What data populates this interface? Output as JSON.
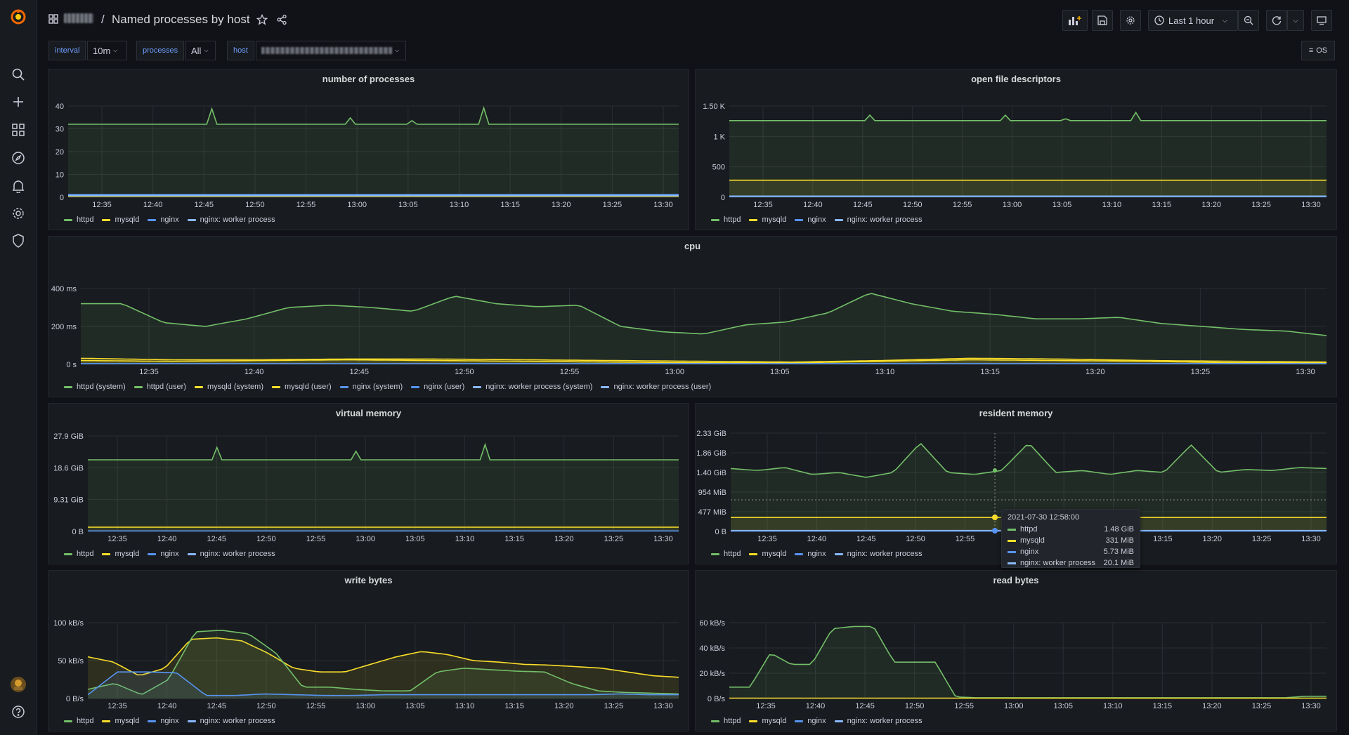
{
  "colors": {
    "httpd": "#73bf69",
    "mysqld": "#fade2a",
    "nginx": "#5794f2",
    "nginx_worker": "#8ab8ff"
  },
  "breadcrumb": {
    "separator": "/",
    "title": "Named processes by host"
  },
  "toolbar": {
    "time_range": "Last 1 hour"
  },
  "variables": [
    {
      "label": "interval",
      "value": "10m"
    },
    {
      "label": "processes",
      "value": "All"
    },
    {
      "label": "host",
      "value": ""
    }
  ],
  "row_toggle": {
    "label": "OS"
  },
  "xticks_hour": [
    "12:35",
    "12:40",
    "12:45",
    "12:50",
    "12:55",
    "13:00",
    "13:05",
    "13:10",
    "13:15",
    "13:20",
    "13:25",
    "13:30"
  ],
  "panels": {
    "processes": {
      "title": "number of processes",
      "yticks": [
        "40",
        "30",
        "20",
        "10",
        "0"
      ]
    },
    "fds": {
      "title": "open file descriptors",
      "yticks": [
        "1.50 K",
        "1 K",
        "500",
        "0"
      ]
    },
    "cpu": {
      "title": "cpu",
      "yticks": [
        "400 ms",
        "200 ms",
        "0 s"
      ]
    },
    "vmem": {
      "title": "virtual memory",
      "yticks": [
        "27.9 GiB",
        "18.6 GiB",
        "9.31 GiB",
        "0 B"
      ]
    },
    "rmem": {
      "title": "resident memory",
      "yticks": [
        "2.33 GiB",
        "1.86 GiB",
        "1.40 GiB",
        "954 MiB",
        "477 MiB",
        "0 B"
      ]
    },
    "write": {
      "title": "write bytes",
      "yticks": [
        "100 kB/s",
        "50 kB/s",
        "0 B/s"
      ]
    },
    "read": {
      "title": "read bytes",
      "yticks": [
        "60 kB/s",
        "40 kB/s",
        "20 kB/s",
        "0 B/s"
      ]
    }
  },
  "legend4": [
    "httpd",
    "mysqld",
    "nginx",
    "nginx: worker process"
  ],
  "legend_cpu": [
    "httpd (system)",
    "httpd (user)",
    "mysqld (system)",
    "mysqld (user)",
    "nginx (system)",
    "nginx (user)",
    "nginx: worker process (system)",
    "nginx: worker process (user)"
  ],
  "tooltip": {
    "time": "2021-07-30 12:58:00",
    "rows": [
      {
        "name": "httpd",
        "value": "1.48 GiB"
      },
      {
        "name": "mysqld",
        "value": "331 MiB"
      },
      {
        "name": "nginx",
        "value": "5.73 MiB"
      },
      {
        "name": "nginx: worker process",
        "value": "20.1 MiB"
      }
    ]
  },
  "chart_data": [
    {
      "type": "area",
      "title": "number of processes",
      "ylim": [
        0,
        40
      ],
      "x": [
        "12:31",
        "12:35",
        "12:40",
        "12:45",
        "12:50",
        "12:55",
        "13:00",
        "13:05",
        "13:10",
        "13:15",
        "13:20",
        "13:25",
        "13:31"
      ],
      "series": [
        {
          "name": "httpd",
          "values": [
            32,
            32,
            32,
            32,
            32,
            32,
            32,
            32,
            32,
            32,
            32,
            32,
            32
          ],
          "spikes": [
            [
              12.75,
              38
            ],
            [
              13.02,
              35
            ],
            [
              13.08,
              34
            ],
            [
              13.15,
              39
            ]
          ]
        },
        {
          "name": "mysqld",
          "values": [
            1,
            1,
            1,
            1,
            1,
            1,
            1,
            1,
            1,
            1,
            1,
            1,
            1
          ]
        },
        {
          "name": "nginx",
          "values": [
            2,
            2,
            2,
            2,
            2,
            2,
            2,
            2,
            2,
            2,
            2,
            2,
            2
          ]
        },
        {
          "name": "nginx: worker process",
          "values": [
            1,
            1,
            1,
            1,
            1,
            1,
            1,
            1,
            1,
            1,
            1,
            1,
            1
          ]
        }
      ]
    },
    {
      "type": "area",
      "title": "open file descriptors",
      "ylim": [
        0,
        1500
      ],
      "series": [
        {
          "name": "httpd",
          "values": [
            1260,
            1260,
            1250,
            1260,
            1260,
            1260,
            1260,
            1260,
            1260,
            1260,
            1260,
            1260,
            1260
          ]
        },
        {
          "name": "mysqld",
          "values": [
            280,
            280,
            280,
            280,
            280,
            280,
            280,
            280,
            280,
            290,
            280,
            280,
            280
          ]
        },
        {
          "name": "nginx",
          "values": [
            10,
            10,
            10,
            10,
            10,
            10,
            10,
            10,
            10,
            10,
            10,
            10,
            10
          ]
        },
        {
          "name": "nginx: worker process",
          "values": [
            20,
            20,
            20,
            20,
            20,
            20,
            20,
            20,
            20,
            20,
            20,
            20,
            20
          ]
        }
      ]
    },
    {
      "type": "area",
      "title": "cpu",
      "ylim": [
        0,
        500
      ],
      "series": [
        {
          "name": "httpd (system)",
          "values": [
            400,
            280,
            300,
            380,
            370,
            380,
            250,
            200,
            300,
            420,
            380,
            300,
            250,
            190
          ]
        },
        {
          "name": "mysqld (system)",
          "values": [
            40,
            30,
            35,
            30,
            25,
            20,
            15,
            20,
            30,
            40,
            30,
            25,
            20,
            15
          ]
        }
      ]
    },
    {
      "type": "area",
      "title": "virtual memory",
      "ylim": [
        0,
        27.9
      ],
      "series": [
        {
          "name": "httpd",
          "values": [
            21,
            21,
            21,
            21,
            21,
            21,
            21,
            21,
            21,
            21,
            21,
            21,
            21
          ]
        },
        {
          "name": "mysqld",
          "values": [
            1.2,
            1.2,
            1.2,
            1.2,
            1.2,
            1.2,
            1.2,
            1.2,
            1.2,
            1.2,
            1.2,
            1.2,
            1.2
          ]
        }
      ]
    },
    {
      "type": "area",
      "title": "resident memory",
      "ylim": [
        0,
        2.33
      ],
      "series": [
        {
          "name": "httpd",
          "values": [
            1.5,
            1.45,
            1.4,
            1.45,
            1.48,
            1.48,
            1.5,
            1.45,
            1.48,
            1.48,
            1.48,
            1.5,
            1.5
          ]
        },
        {
          "name": "mysqld",
          "values": [
            0.33,
            0.33,
            0.33,
            0.33,
            0.33,
            0.33,
            0.33,
            0.33,
            0.33,
            0.33,
            0.33,
            0.33,
            0.33
          ]
        }
      ]
    },
    {
      "type": "area",
      "title": "write bytes",
      "ylim": [
        0,
        120
      ],
      "series": [
        {
          "name": "httpd",
          "values": [
            15,
            10,
            100,
            105,
            20,
            15,
            15,
            45,
            40,
            35,
            15,
            10,
            8
          ]
        },
        {
          "name": "mysqld",
          "values": [
            70,
            50,
            100,
            95,
            60,
            55,
            50,
            75,
            65,
            60,
            55,
            45,
            35
          ]
        },
        {
          "name": "nginx",
          "values": [
            5,
            40,
            40,
            5,
            5,
            5,
            5,
            5,
            5,
            5,
            5,
            5,
            5
          ]
        }
      ]
    },
    {
      "type": "area",
      "title": "read bytes",
      "ylim": [
        0,
        80
      ],
      "series": [
        {
          "name": "httpd",
          "values": [
            10,
            45,
            35,
            70,
            70,
            35,
            0,
            0,
            0,
            0,
            0,
            0,
            2
          ]
        },
        {
          "name": "mysqld",
          "values": [
            0,
            0,
            0,
            0,
            0,
            0,
            0,
            0,
            0,
            0,
            0,
            0,
            0
          ]
        }
      ]
    }
  ]
}
